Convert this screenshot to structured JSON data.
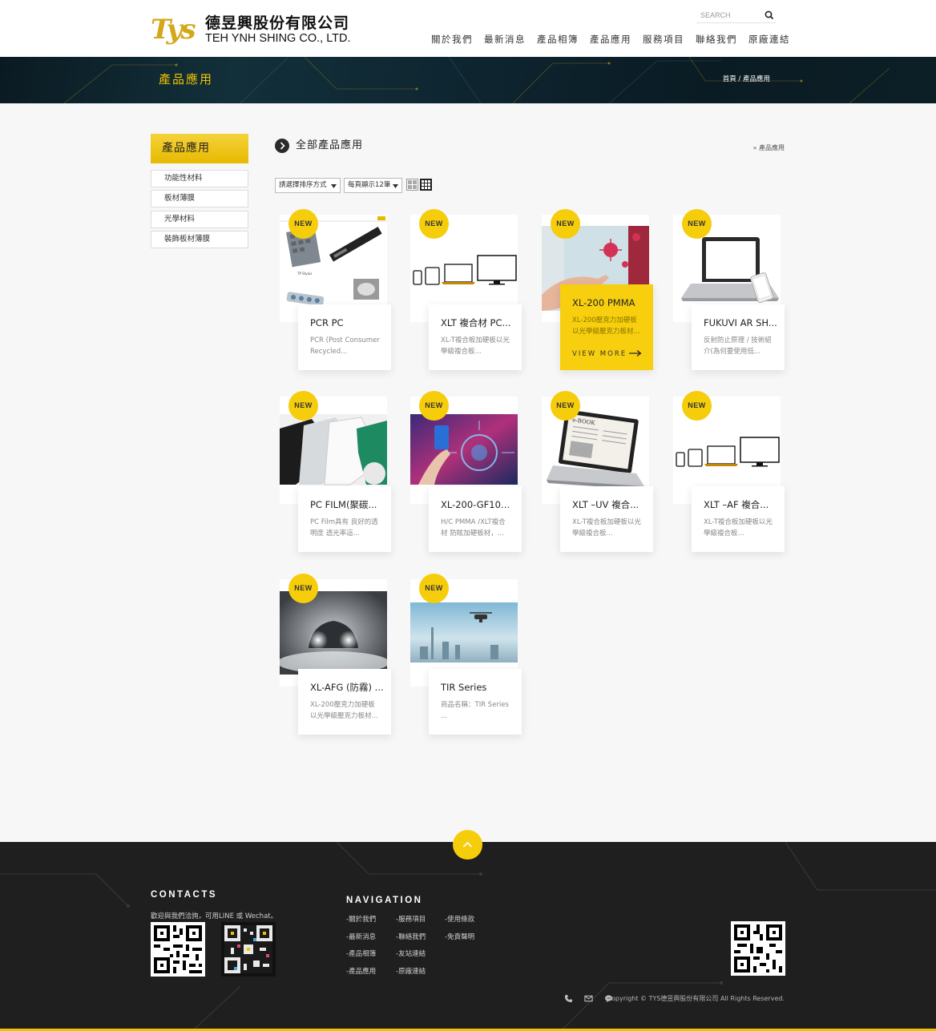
{
  "header": {
    "logo_mark": "Tys",
    "company_cn": "德昱興股份有限公司",
    "company_en": "TEH YNH SHING CO., LTD.",
    "search_placeholder": "SEARCH",
    "nav": [
      "關於我們",
      "最新消息",
      "產品相簿",
      "產品應用",
      "服務項目",
      "聯絡我們",
      "原廠連結"
    ]
  },
  "banner": {
    "title": "產品應用",
    "breadcrumb": "首頁 / 產品應用"
  },
  "sidebar": {
    "title": "產品應用",
    "items": [
      {
        "label": "功能性材料"
      },
      {
        "label": "板材薄膜"
      },
      {
        "label": "光學材料"
      },
      {
        "label": "裝飾板材薄膜"
      }
    ]
  },
  "main": {
    "heading": "全部產品應用",
    "crumb": "» 產品應用",
    "sort_select": "請選擇排序方式",
    "per_page_select": "每頁顯示12筆",
    "badge_label": "NEW",
    "view_more": "VIEW MORE",
    "products": [
      {
        "title": "PCR PC",
        "desc": "PCR (Post Consumer Recycled...",
        "image": "pcr-sheet-collage"
      },
      {
        "title": "XLT 複合材 PC...",
        "desc": "XL-T複合板加硬板以光學級複合板...",
        "image": "devices-lineup"
      },
      {
        "title": "XL-200 PMMA",
        "desc": "XL-200壓克力加硬板以光學級壓克力板材...",
        "image": "touch-screen-hand",
        "active": true
      },
      {
        "title": "FUKUVI AR SH...",
        "desc": "反射防止原理 / 技術紹介(為何要使用低...",
        "image": "laptop-phone"
      },
      {
        "title": "PC FILM(聚碳...",
        "desc": "PC Film具有 良好的透明度 透光率這...",
        "image": "film-rolls"
      },
      {
        "title": "XL-200-GF10X...",
        "desc": "H/C PMMA /XLT複合材 防眩加硬板材，...",
        "image": "car-dashboard-hud"
      },
      {
        "title": "XLT –UV 複合...",
        "desc": "XL-T複合板加硬板以光學級複合板...",
        "image": "laptop-ebook"
      },
      {
        "title": "XLT –AF 複合...",
        "desc": "XL-T複合板加硬板以光學級複合板...",
        "image": "devices-lineup"
      },
      {
        "title": "XL-AFG (防霧) ...",
        "desc": "XL-200壓克力加硬板以光學級壓克力板材...",
        "image": "car-headlights-fog"
      },
      {
        "title": "TIR Series",
        "desc": "商品名稱：TIR Series ...",
        "image": "drone-city"
      }
    ]
  },
  "footer": {
    "contacts_title": "CONTACTS",
    "contacts_text": "歡迎與我們洽詢，可用LINE 或 Wechat。",
    "navigation_title": "NAVIGATION",
    "links": [
      [
        "-關於我們",
        "-服務項目",
        "-使用條款"
      ],
      [
        "-最新消息",
        "-聯絡我們",
        "-免責聲明"
      ],
      [
        "-產品相簿",
        "-友站連結"
      ],
      [
        "-產品應用",
        "-原廠連結"
      ]
    ],
    "copyright": "Copyright © TYS德昱興股份有限公司 All Rights Reserved.",
    "icons": [
      "phone-icon",
      "mail-icon",
      "chat-icon"
    ]
  },
  "colors": {
    "accent": "#f6cd0b",
    "banner_title": "#f2c200",
    "footer_bg": "#1f1f20",
    "logo_gold": "#d4a719"
  }
}
